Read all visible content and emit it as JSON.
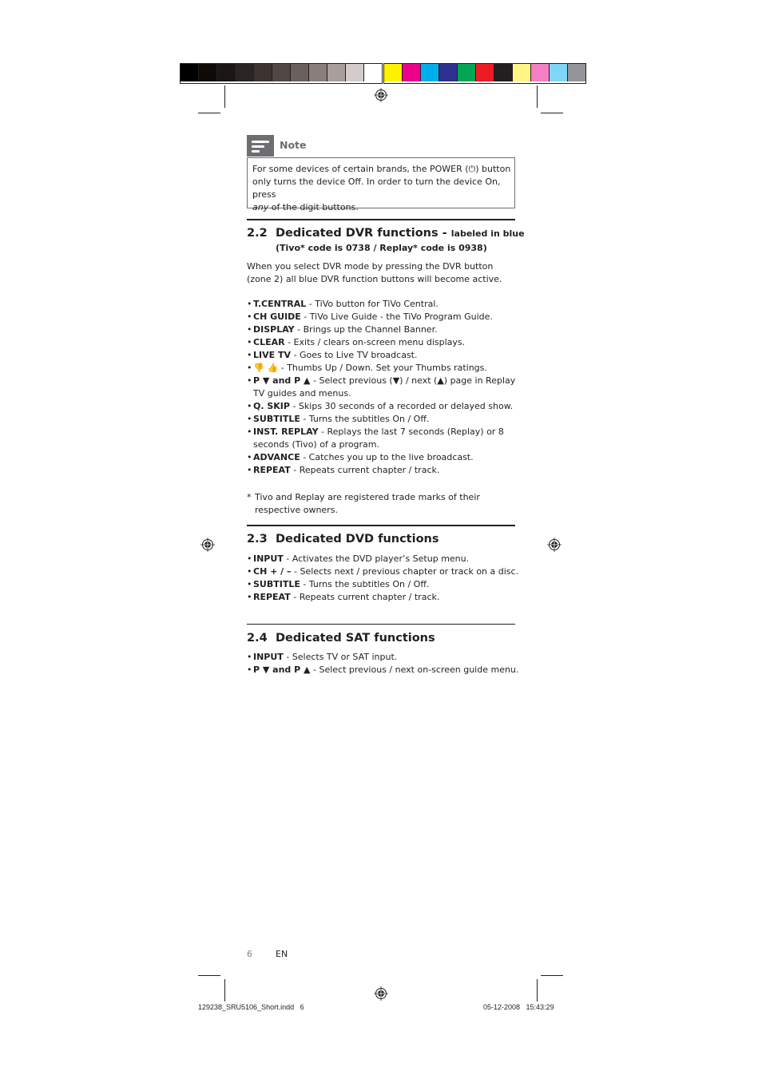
{
  "print_marks": {
    "gray_swatches": [
      "#000000",
      "#0d0a08",
      "#1a1614",
      "#2a2522",
      "#3d3431",
      "#514845",
      "#6a605c",
      "#8a7f7a",
      "#a89e9b",
      "#d4cccb",
      "#ffffff"
    ],
    "color_swatches": [
      "#fff200",
      "#ec008c",
      "#00aeef",
      "#2e3192",
      "#00a651",
      "#ed1c24",
      "#231f20",
      "#fff685",
      "#f380c4",
      "#7fd6f7",
      "#939598"
    ]
  },
  "note": {
    "icon": "note-lines-icon",
    "label": "Note",
    "text_line1": "For some devices of certain brands, the POWER (⏻)  button",
    "text_line2": "only turns the device Off. In order to turn the device On, press",
    "text_line3_em": "any",
    "text_line3_rest": " of the digit buttons."
  },
  "sections": {
    "dvr": {
      "number": "2.2",
      "title": "Dedicated DVR functions - ",
      "title_suffix": "labeled in blue",
      "subtitle": "(Tivo* code is 0738 / Replay* code is 0938)",
      "intro_line1": "When you select DVR mode by pressing the DVR button",
      "intro_line2": "(zone 2) all blue DVR function buttons will become active.",
      "items": [
        {
          "key": "T.CENTRAL",
          "desc": " - TiVo button for TiVo Central."
        },
        {
          "key": "CH GUIDE",
          "desc": " - TiVo Live Guide - the TiVo Program Guide."
        },
        {
          "key": "DISPLAY",
          "desc": " - Brings up the Channel Banner."
        },
        {
          "key": "CLEAR",
          "desc": " - Exits / clears on-screen menu displays."
        },
        {
          "key": "LIVE TV",
          "desc": " - Goes to Live TV broadcast."
        },
        {
          "key": "👎 👍",
          "desc": " -  Thumbs Up / Down. Set your Thumbs ratings."
        },
        {
          "key": "P ▼ and P ▲",
          "desc": " - Select previous (▼) / next (▲) page in Replay TV guides and menus."
        },
        {
          "key": "Q. SKIP",
          "desc": " - Skips 30 seconds of a recorded or delayed show."
        },
        {
          "key": "SUBTITLE",
          "desc": " - Turns the subtitles On / Off."
        },
        {
          "key": "INST. REPLAY",
          "desc": " - Replays the last 7 seconds (Replay) or 8 seconds (Tivo) of a program."
        },
        {
          "key": "ADVANCE",
          "desc": " - Catches you up to the live broadcast."
        },
        {
          "key": "REPEAT",
          "desc": " - Repeats current chapter / track."
        }
      ],
      "footnote_star": "*",
      "footnote": "Tivo and Replay are registered trade marks of their respective owners."
    },
    "dvd": {
      "number": "2.3",
      "title": "Dedicated DVD functions",
      "items": [
        {
          "key": "INPUT",
          "desc": " - Activates the DVD player’s Setup menu."
        },
        {
          "key": "CH + / –",
          "desc": " - Selects next / previous chapter or track on a disc."
        },
        {
          "key": "SUBTITLE",
          "desc": " - Turns the subtitles On / Off."
        },
        {
          "key": "REPEAT",
          "desc": " - Repeats current chapter / track."
        }
      ]
    },
    "sat": {
      "number": "2.4",
      "title": "Dedicated SAT functions",
      "items": [
        {
          "key": "INPUT",
          "desc": " - Selects TV or SAT input."
        },
        {
          "key": "P ▼ and P ▲",
          "desc": " - Select previous / next on-screen guide menu."
        }
      ]
    }
  },
  "footer": {
    "page_number": "6",
    "language": "EN",
    "slug_file": "129238_SRU5106_Short.indd   6",
    "slug_date": "05-12-2008   15:43:29"
  }
}
